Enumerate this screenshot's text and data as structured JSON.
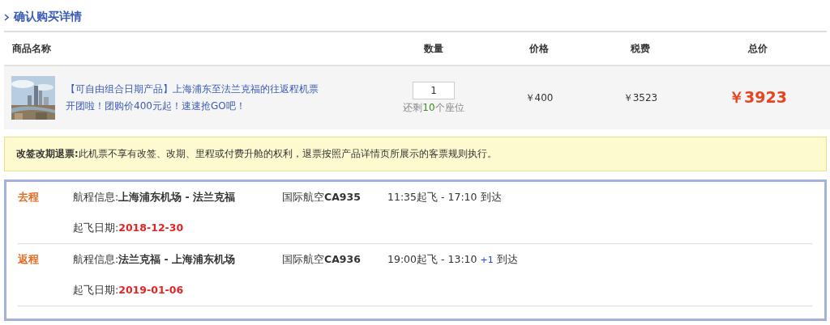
{
  "section_title": "确认购买详情",
  "table": {
    "columns": [
      "商品名称",
      "数量",
      "价格",
      "税费",
      "总价"
    ],
    "rows": [
      {
        "title": "【可自由组合日期产品】上海浦东至法兰克福的往返程机票",
        "subtitle": "开团啦！团购价400元起！速速抢GO吧！",
        "quantity": "1",
        "remaining_prefix": "还剩",
        "remaining_count": "10",
        "remaining_suffix": "个座位",
        "price": "￥400",
        "tax": "￥3523",
        "total": "￥3923"
      }
    ]
  },
  "notice": "**改签改期退票:**此机票不享有改签、改期、里程或付费升舱的权利，退票按照产品详情页所展示的客票规则执行。",
  "flights": [
    {
      "direction": "去程",
      "route": "航程信息:**上海浦东机场 - 法兰克福**",
      "flight": "国际航空**CA935**",
      "times": "11:35起飞 - 17:10",
      "arrive": "到达",
      "date_label": "起飞日期:",
      "date": "2018-12-30"
    },
    {
      "direction": "返程",
      "route": "航程信息:**法兰克福 - 上海浦东机场**",
      "flight": "国际航空**CA936**",
      "times": "19:00起飞 - 13:10",
      "next_day": "+1",
      "arrive": "到达",
      "date_label": "起飞日期:",
      "date": "2019-01-06"
    }
  ]
}
